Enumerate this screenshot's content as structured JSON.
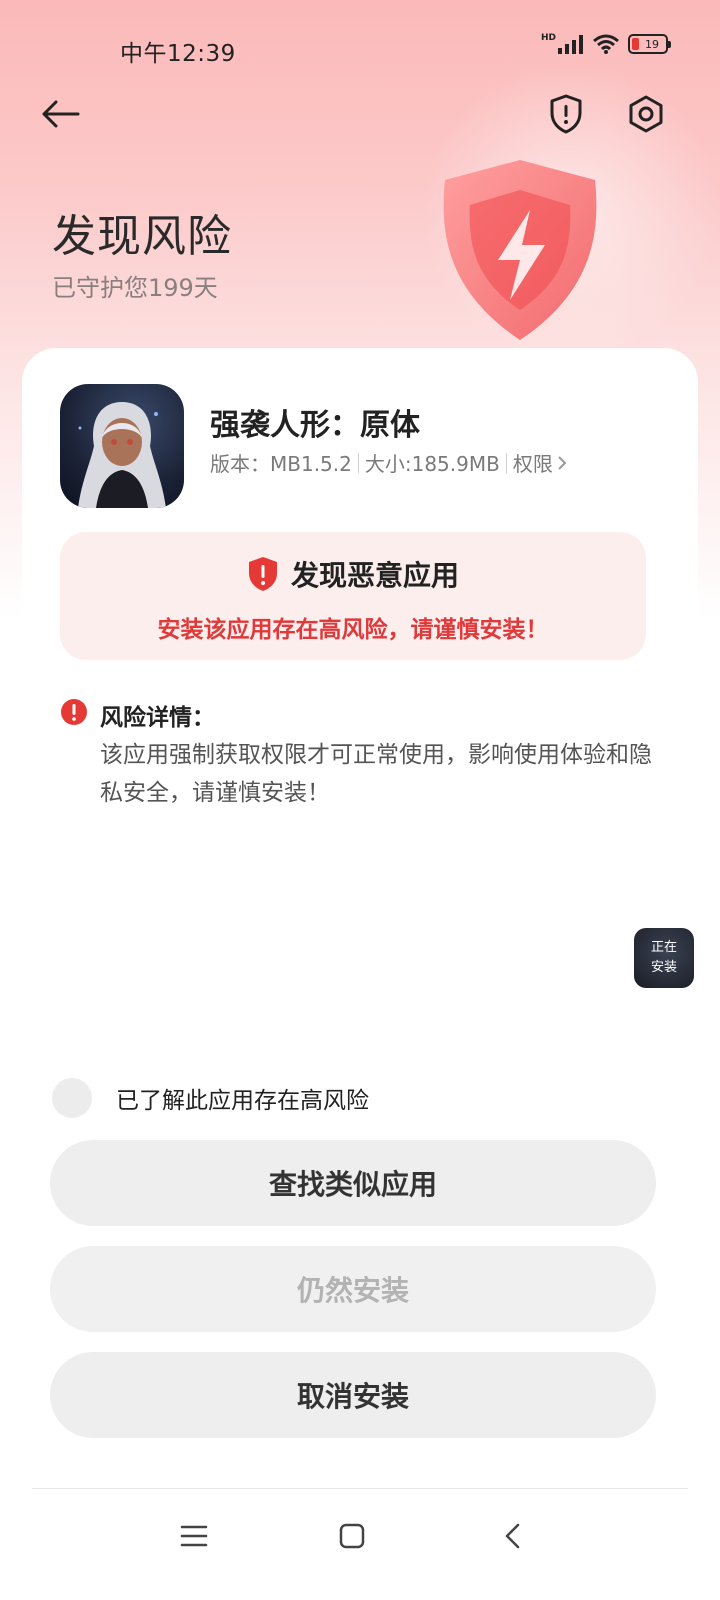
{
  "status_bar": {
    "time": "中午12:39",
    "network_badge": "HD",
    "battery_level": "19"
  },
  "header": {
    "title": "发现风险",
    "subtitle": "已守护您199天"
  },
  "app": {
    "name": "强袭人形：原体",
    "version": "版本：MB1.5.2",
    "size": "大小:185.9MB",
    "permissions_label": "权限"
  },
  "alert": {
    "title": "发现恶意应用",
    "description": "安装该应用存在高风险，请谨慎安装！"
  },
  "risk_details": {
    "title": "风险详情：",
    "body": "该应用强制获取权限才可正常使用，影响使用体验和隐私安全，请谨慎安装！"
  },
  "floating_install": {
    "line1": "正在",
    "line2": "安装"
  },
  "acknowledge": {
    "label": "已了解此应用存在高风险",
    "checked": false
  },
  "buttons": {
    "find_similar": "查找类似应用",
    "install_anyway": "仍然安装",
    "cancel_install": "取消安装"
  },
  "colors": {
    "danger": "#e0393a",
    "alert_bg": "#fdeeee",
    "button_bg": "#eeeeee"
  },
  "icons": [
    "back-arrow-icon",
    "shield-alert-icon",
    "settings-icon",
    "danger-shield-icon",
    "info-icon",
    "menu-icon",
    "home-icon",
    "nav-back-icon"
  ]
}
